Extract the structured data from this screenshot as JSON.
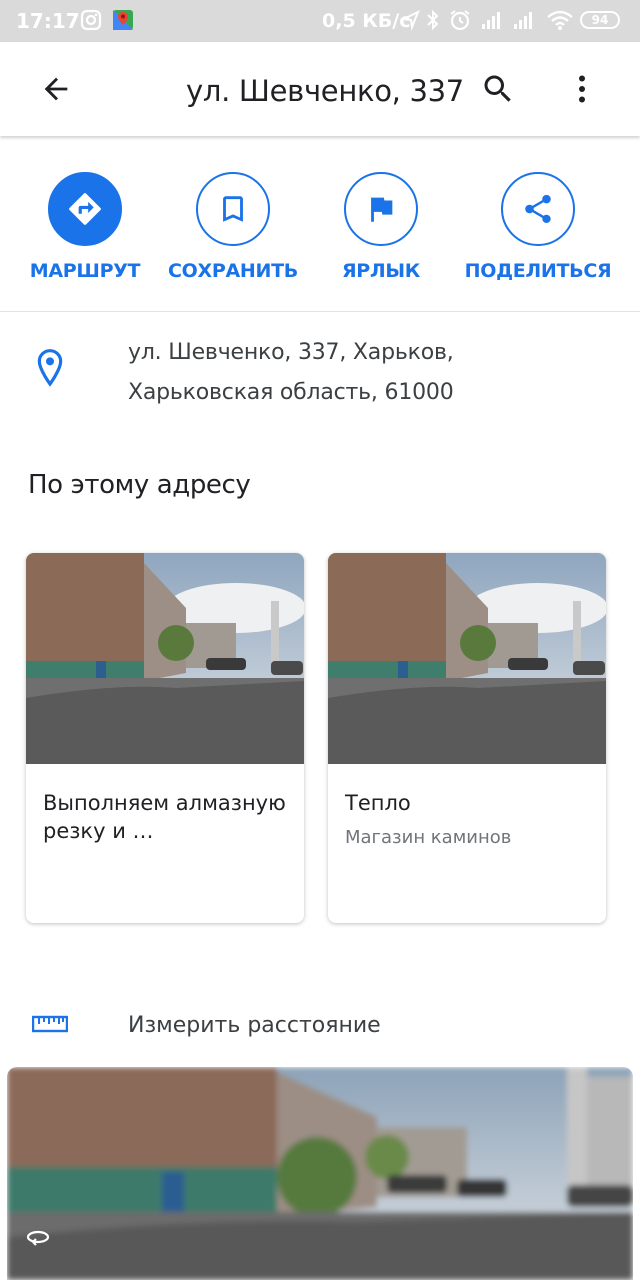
{
  "status_bar": {
    "time": "17:17",
    "speed": "0,5 КБ/с",
    "battery": "94"
  },
  "app_bar": {
    "title": "ул. Шевченко, 337"
  },
  "actions": [
    {
      "label": "МАРШРУТ"
    },
    {
      "label": "СОХРАНИТЬ"
    },
    {
      "label": "ЯРЛЫК"
    },
    {
      "label": "ПОДЕЛИТЬСЯ"
    }
  ],
  "address": {
    "line1": "ул. Шевченко, 337, Харьков,",
    "line2": "Харьковская область, 61000"
  },
  "section": {
    "title": "По этому адресу"
  },
  "cards": [
    {
      "title": "Выполняем алмазную резку и …",
      "subtitle": ""
    },
    {
      "title": "Тепло",
      "subtitle": "Магазин каминов"
    }
  ],
  "measure": {
    "label": "Измерить расстояние"
  },
  "colors": {
    "accent": "#1a73e8",
    "status_bar": "#dadada",
    "text_primary": "#202124",
    "text_secondary": "#70757a"
  }
}
